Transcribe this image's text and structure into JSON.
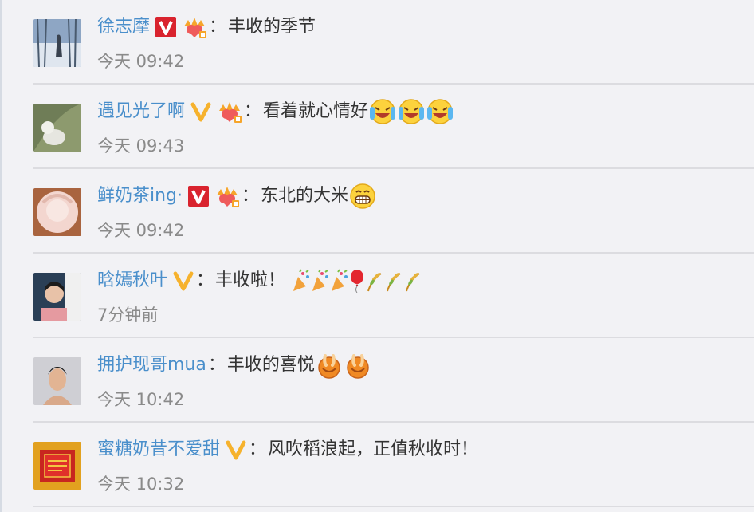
{
  "comments": [
    {
      "username": "徐志摩",
      "text": "丰收的季节",
      "time": "今天 09:42",
      "verify_icon": "red-v-icon",
      "crown_icon": "crown-level-icon",
      "emojis": []
    },
    {
      "username": "遇见光了啊",
      "text": "看着就心情好",
      "time": "今天 09:43",
      "verify_icon": "yellow-v-icon",
      "crown_icon": "crown-level-icon",
      "emojis": [
        "laughing-tears-emoji",
        "laughing-tears-emoji",
        "laughing-tears-emoji"
      ]
    },
    {
      "username": "鲜奶茶ing·",
      "text": "东北的大米",
      "time": "今天 09:42",
      "verify_icon": "red-v-icon",
      "crown_icon": "crown-level-icon",
      "emojis": [
        "grinning-emoji"
      ]
    },
    {
      "username": "晗嫣秋叶",
      "text": "丰收啦！",
      "time": "7分钟前",
      "verify_icon": "yellow-v-icon",
      "crown_icon": "",
      "emojis": [
        "party-popper-emoji",
        "party-popper-emoji",
        "party-popper-emoji",
        "balloon-emoji",
        "wheat-emoji",
        "wheat-emoji",
        "wheat-emoji"
      ]
    },
    {
      "username": "拥护现哥mua",
      "text": "丰收的喜悦",
      "time": "今天 10:42",
      "verify_icon": "",
      "crown_icon": "",
      "emojis": [
        "thumbs-up-emoji",
        "thumbs-up-emoji"
      ]
    },
    {
      "username": "蜜糖奶昔不爱甜",
      "text": "风吹稻浪起，正值秋收时！",
      "time": "今天 10:32",
      "verify_icon": "yellow-v-icon",
      "crown_icon": "",
      "emojis": []
    }
  ],
  "colon": "：",
  "colors": {
    "username": "#4a8fcb",
    "text": "#333333",
    "time": "#8a8a8a",
    "background": "#f2f2f5",
    "divider": "#dcdce0",
    "red_v": "#d9232e",
    "yellow_v": "#f6b22d"
  }
}
